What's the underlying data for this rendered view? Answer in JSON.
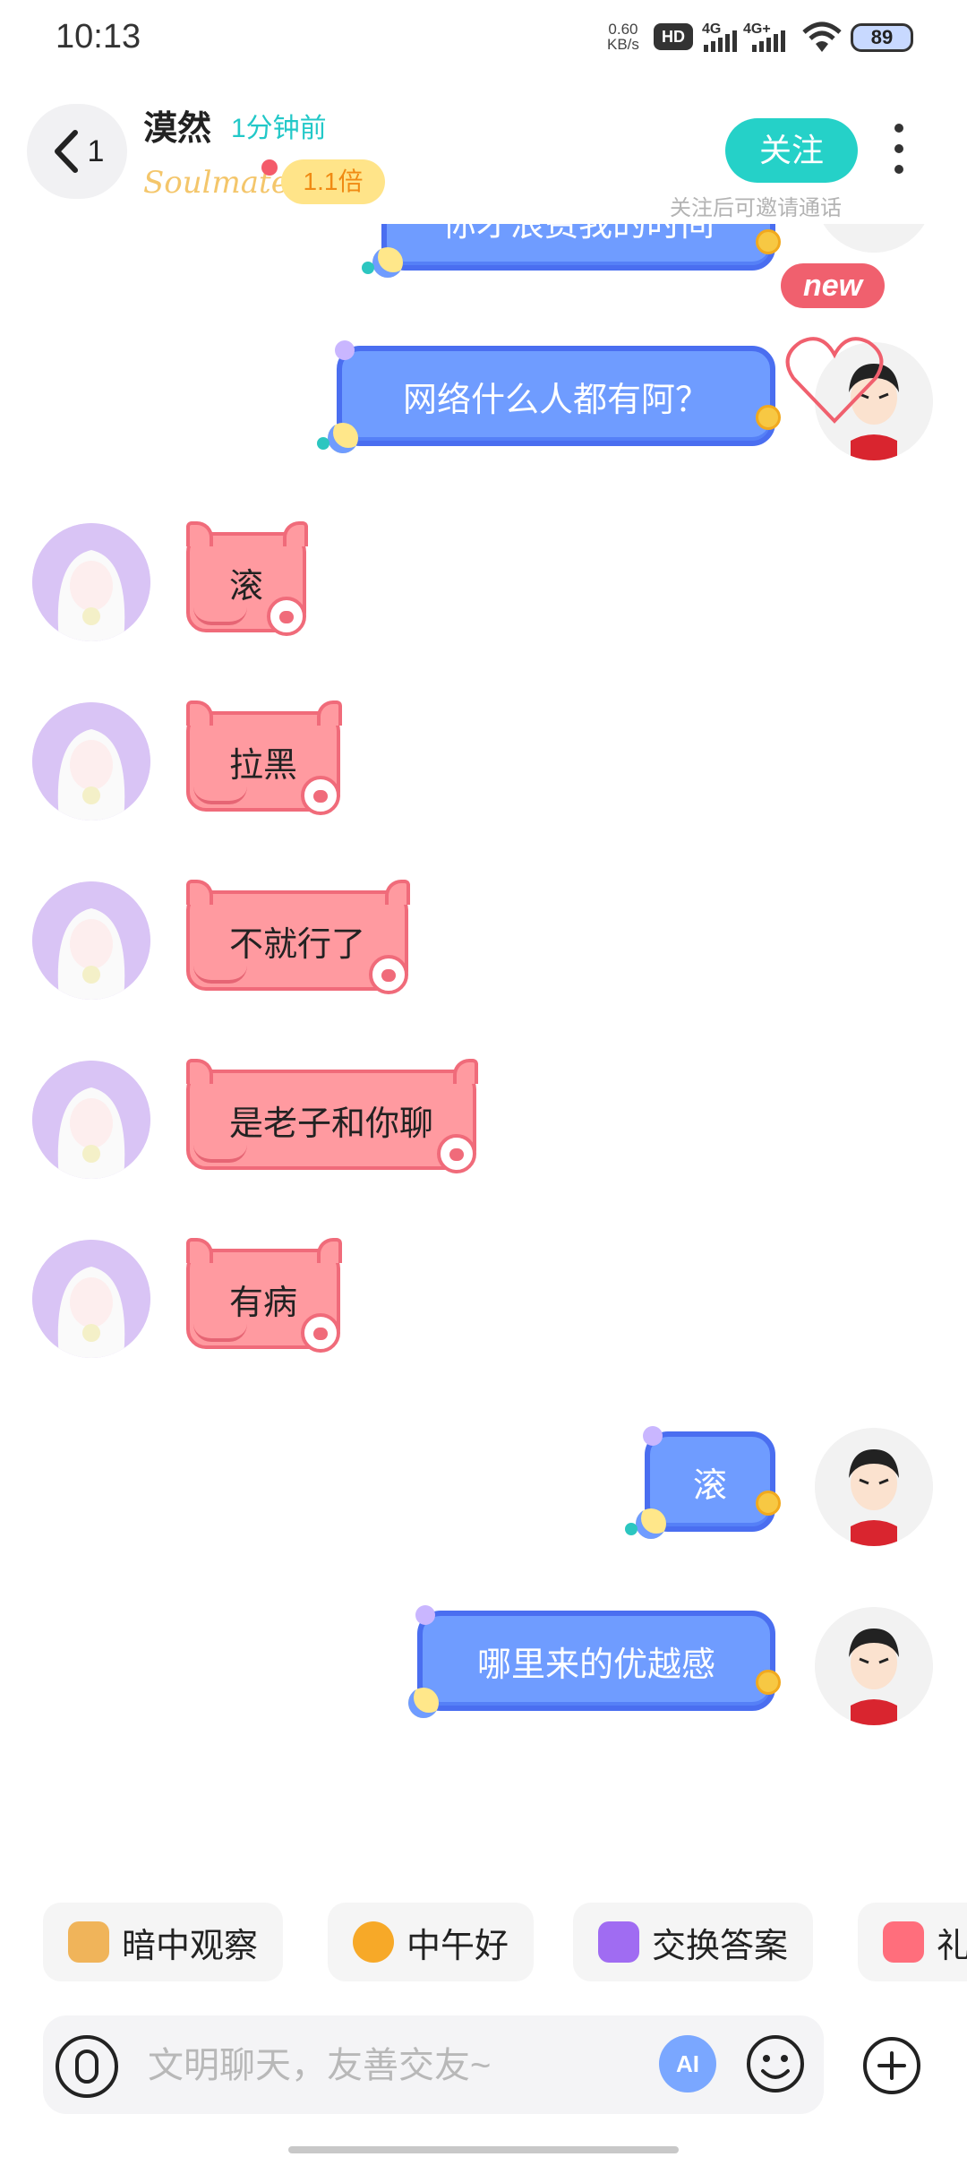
{
  "status_bar": {
    "time": "10:13",
    "net_speed_value": "0.60",
    "net_speed_unit": "KB/s",
    "hd_label": "HD",
    "sig1_label": "4G",
    "sig2_label": "4G+",
    "battery": "89"
  },
  "header": {
    "back_count": "1",
    "name": "漠然",
    "last_seen": "1分钟前",
    "soulmate": "Soulmate",
    "multiplier": "1.1倍",
    "follow_label": "关注",
    "follow_hint": "关注后可邀请通话"
  },
  "badge": {
    "new_label": "new"
  },
  "messages": [
    {
      "from": "me",
      "text": "你才浪费我的时间"
    },
    {
      "from": "me",
      "text": "网络什么人都有阿？"
    },
    {
      "from": "her",
      "text": "滚"
    },
    {
      "from": "her",
      "text": "拉黑"
    },
    {
      "from": "her",
      "text": "不就行了"
    },
    {
      "from": "her",
      "text": "是老子和你聊"
    },
    {
      "from": "her",
      "text": "有病"
    },
    {
      "from": "me",
      "text": "滚"
    },
    {
      "from": "me",
      "text": "哪里来的优越感"
    }
  ],
  "quick_replies": [
    {
      "label": "暗中观察",
      "icon": "peeking-dog-icon"
    },
    {
      "label": "中午好",
      "icon": "sun-sunglasses-icon"
    },
    {
      "label": "交换答案",
      "icon": "swap-icon"
    },
    {
      "label": "礼",
      "icon": "gift-icon"
    }
  ],
  "input": {
    "placeholder": "文明聊天，友善交友~",
    "ai_label": "AI"
  },
  "colors": {
    "accent": "#25d1c8",
    "my_bubble": "#6f9cff",
    "her_bubble": "#ff9aa0",
    "badge": "#f0606e"
  }
}
